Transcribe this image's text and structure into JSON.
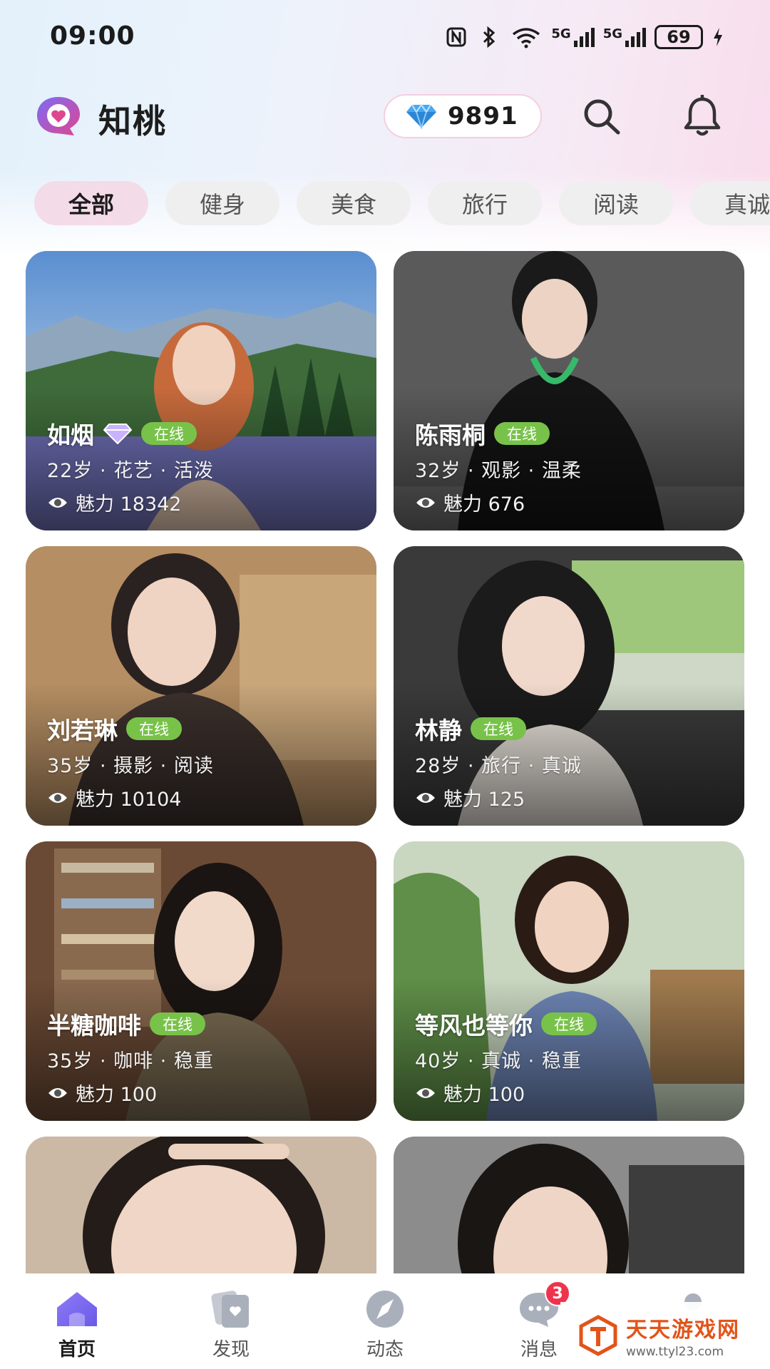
{
  "status_bar": {
    "time": "09:00",
    "signal_label_1": "5G",
    "signal_label_2": "5G",
    "battery": "69",
    "icons": [
      "nfc-icon",
      "bluetooth-icon",
      "wifi-icon",
      "signal-icon",
      "signal-icon",
      "battery-icon",
      "charging-icon"
    ]
  },
  "header": {
    "app_name": "知桃",
    "diamond_count": "9891",
    "icons": [
      "app-logo-icon",
      "diamond-icon",
      "search-icon",
      "bell-icon"
    ]
  },
  "categories": [
    {
      "label": "全部",
      "active": true
    },
    {
      "label": "健身",
      "active": false
    },
    {
      "label": "美食",
      "active": false
    },
    {
      "label": "旅行",
      "active": false
    },
    {
      "label": "阅读",
      "active": false
    },
    {
      "label": "真诚",
      "active": false
    }
  ],
  "cards": [
    {
      "name": "如烟",
      "vip": true,
      "online": "在线",
      "meta": "22岁 · 花艺 · 活泼",
      "charm": "魅力 18342"
    },
    {
      "name": "陈雨桐",
      "vip": false,
      "online": "在线",
      "meta": "32岁 · 观影 · 温柔",
      "charm": "魅力 676"
    },
    {
      "name": "刘若琳",
      "vip": false,
      "online": "在线",
      "meta": "35岁 · 摄影 · 阅读",
      "charm": "魅力 10104"
    },
    {
      "name": "林静",
      "vip": false,
      "online": "在线",
      "meta": "28岁 · 旅行 · 真诚",
      "charm": "魅力 125"
    },
    {
      "name": "半糖咖啡",
      "vip": false,
      "online": "在线",
      "meta": "35岁 · 咖啡 · 稳重",
      "charm": "魅力 100"
    },
    {
      "name": "等风也等你",
      "vip": false,
      "online": "在线",
      "meta": "40岁 · 真诚 · 稳重",
      "charm": "魅力 100"
    }
  ],
  "bottom_nav": [
    {
      "label": "首页",
      "icon": "home-icon",
      "active": true
    },
    {
      "label": "发现",
      "icon": "discover-cards-icon",
      "active": false
    },
    {
      "label": "动态",
      "icon": "compass-icon",
      "active": false
    },
    {
      "label": "消息",
      "icon": "chat-bubble-icon",
      "active": false,
      "badge": "3"
    },
    {
      "label": "",
      "icon": "profile-icon",
      "active": false
    }
  ],
  "watermark": {
    "title": "天天游戏网",
    "url": "www.ttyl23.com"
  },
  "colors": {
    "accent_pink": "#f4dbe8",
    "online_green": "#78c24a",
    "brand_purple": "#8b5cf6",
    "badge_red": "#f0334d"
  }
}
